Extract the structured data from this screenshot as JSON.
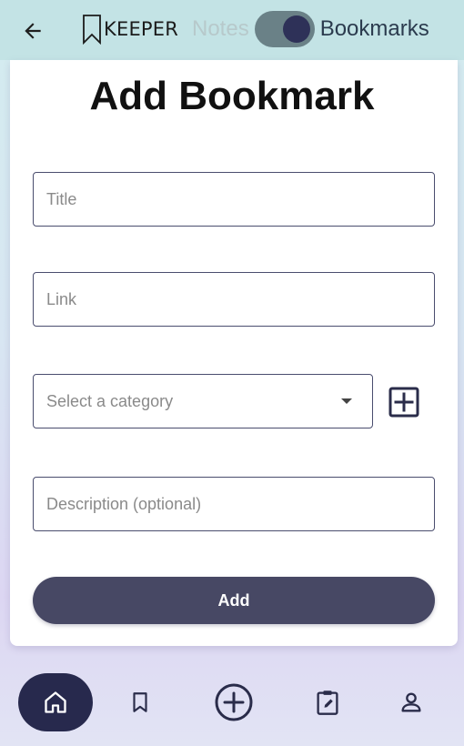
{
  "header": {
    "logo_text": "KEEPER",
    "toggle_left_label": "Notes",
    "toggle_right_label": "Bookmarks"
  },
  "form": {
    "title": "Add Bookmark",
    "title_placeholder": "Title",
    "link_placeholder": "Link",
    "category_placeholder": "Select a category",
    "description_placeholder": "Description (optional)",
    "submit_label": "Add"
  },
  "icons": {
    "back": "arrow-left-icon",
    "logo": "bookmark-icon",
    "add_category": "plus-square-icon",
    "dropdown": "caret-down-icon",
    "nav": [
      "home-icon",
      "bookmark-icon",
      "plus-circle-icon",
      "clipboard-edit-icon",
      "person-icon"
    ]
  },
  "colors": {
    "header_bg": "#c3e3e5",
    "accent": "#474864",
    "nav_active": "#27294d"
  }
}
